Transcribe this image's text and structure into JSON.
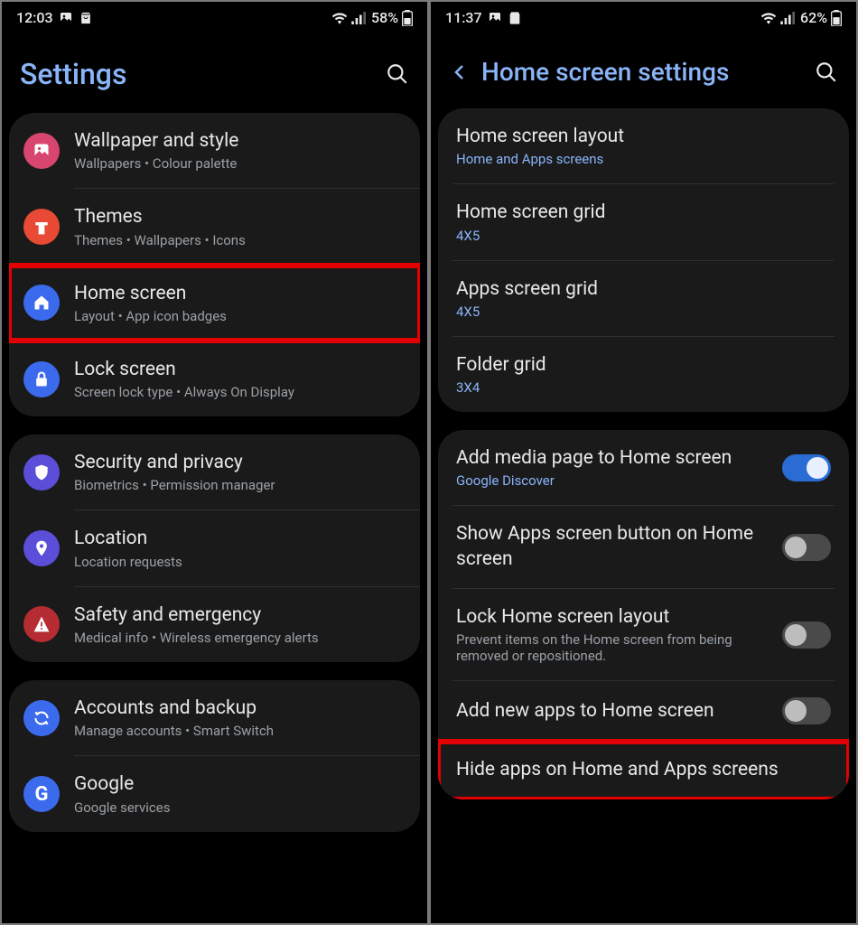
{
  "left": {
    "status": {
      "time": "12:03",
      "battery": "58%"
    },
    "title": "Settings",
    "group1": [
      {
        "title": "Wallpaper and style",
        "sub": "Wallpapers  •  Colour palette"
      },
      {
        "title": "Themes",
        "sub": "Themes  •  Wallpapers  •  Icons"
      },
      {
        "title": "Home screen",
        "sub": "Layout  •  App icon badges"
      },
      {
        "title": "Lock screen",
        "sub": "Screen lock type  •  Always On Display"
      }
    ],
    "group2": [
      {
        "title": "Security and privacy",
        "sub": "Biometrics  •  Permission manager"
      },
      {
        "title": "Location",
        "sub": "Location requests"
      },
      {
        "title": "Safety and emergency",
        "sub": "Medical info  •  Wireless emergency alerts"
      }
    ],
    "group3": [
      {
        "title": "Accounts and backup",
        "sub": "Manage accounts  •  Smart Switch"
      },
      {
        "title": "Google",
        "sub": "Google services"
      }
    ]
  },
  "right": {
    "status": {
      "time": "11:37",
      "battery": "62%"
    },
    "title": "Home screen settings",
    "group1": [
      {
        "title": "Home screen layout",
        "sub": "Home and Apps screens"
      },
      {
        "title": "Home screen grid",
        "sub": "4X5"
      },
      {
        "title": "Apps screen grid",
        "sub": "4X5"
      },
      {
        "title": "Folder grid",
        "sub": "3X4"
      }
    ],
    "group2": [
      {
        "title": "Add media page to Home screen",
        "sub": "Google Discover",
        "toggle": "on"
      },
      {
        "title": "Show Apps screen button on Home screen",
        "toggle": "off"
      },
      {
        "title": "Lock Home screen layout",
        "sub": "Prevent items on the Home screen from being removed or repositioned.",
        "toggle": "off"
      },
      {
        "title": "Add new apps to Home screen",
        "toggle": "off"
      },
      {
        "title": "Hide apps on Home and Apps screens"
      }
    ]
  }
}
